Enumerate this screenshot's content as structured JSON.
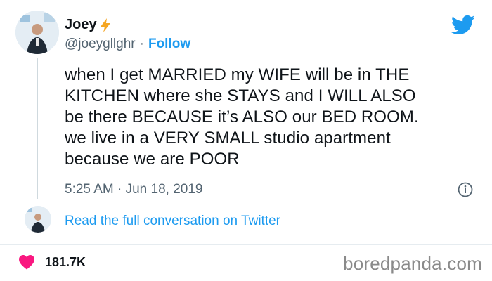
{
  "author": {
    "display_name": "Joey",
    "handle": "@joeygllghr",
    "separator": "·",
    "follow_label": "Follow"
  },
  "tweet": {
    "text": "when I get MARRIED my WIFE will be in THE\nKITCHEN where she STAYS and I WILL ALSO\nbe there BECAUSE it’s ALSO our BED ROOM.\nwe live in a VERY SMALL studio apartment\nbecause we are POOR",
    "timestamp": "5:25 AM · Jun 18, 2019"
  },
  "conversation_link": "Read the full conversation on Twitter",
  "stats": {
    "likes": "181.7K"
  },
  "watermark": "boredpanda.com",
  "colors": {
    "accent": "#1d9bf0",
    "heart": "#f91880",
    "bolt": "#f5a623",
    "muted": "#536471"
  },
  "icons": [
    "lightning-bolt-icon",
    "twitter-bird-icon",
    "info-icon",
    "heart-icon"
  ]
}
